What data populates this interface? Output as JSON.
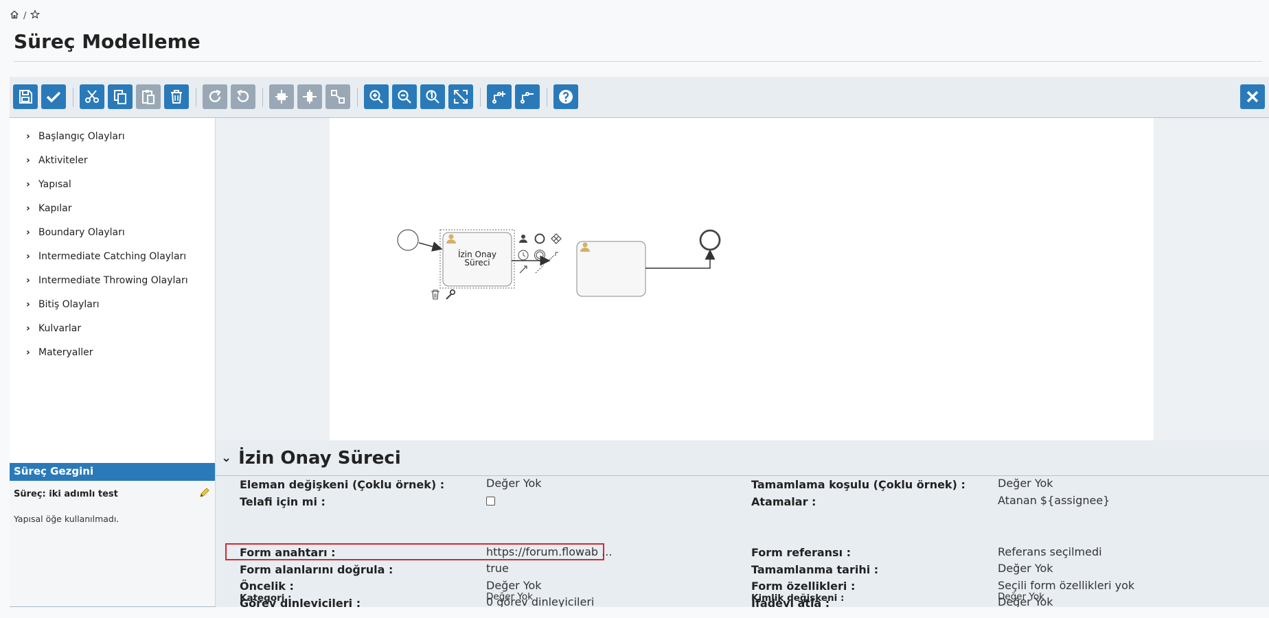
{
  "page": {
    "title": "Süreç Modelleme"
  },
  "breadcrumb": {
    "separator": "/"
  },
  "toolbar": {
    "buttons": [
      "save-icon",
      "check-icon",
      "cut-icon",
      "copy-icon",
      "paste-icon",
      "delete-icon",
      "redo-icon",
      "undo-icon",
      "align-vertical-icon",
      "align-horizontal-icon",
      "same-size-icon",
      "zoom-in-icon",
      "zoom-out-icon",
      "zoom-actual-icon",
      "zoom-fit-icon",
      "add-bendpoint-icon",
      "remove-bendpoint-icon",
      "help-icon"
    ],
    "close": "close-icon",
    "colors": {
      "primary": "#2a7ab9",
      "disabled": "#9aa8b5"
    }
  },
  "palette": {
    "items": [
      "Başlangıç Olayları",
      "Aktiviteler",
      "Yapısal",
      "Kapılar",
      "Boundary Olayları",
      "Intermediate Catching Olayları",
      "Intermediate Throwing Olayları",
      "Bitiş Olayları",
      "Kulvarlar",
      "Materyaller"
    ]
  },
  "diagram": {
    "task1_label": "İzin Onay\nSüreci",
    "task1_line1": "İzin Onay",
    "task1_line2": "Süreci"
  },
  "navigator": {
    "title": "Süreç Gezgini",
    "process_label": "Süreç: iki adımlı test",
    "empty_text": "Yapısal öğe kullanılmadı."
  },
  "properties": {
    "title": "İzin Onay Süreci",
    "left": [
      {
        "label": "Eleman değişkeni (Çoklu örnek) :",
        "value": "Değer Yok"
      },
      {
        "label": "Telafi için mi :",
        "value": ""
      },
      {
        "label": "Form anahtarı :",
        "value": "https://forum.flowab ..."
      },
      {
        "label": "Form alanlarını doğrula :",
        "value": "true"
      },
      {
        "label": "Öncelik :",
        "value": "Değer Yok"
      },
      {
        "label": "Görev dinleyicileri :",
        "value": "0 görev dinleyicileri"
      },
      {
        "label": "Kategori :",
        "value": "Değer Yok"
      }
    ],
    "right": [
      {
        "label": "Tamamlama koşulu (Çoklu örnek) :",
        "value": "Değer Yok"
      },
      {
        "label": "Atamalar :",
        "value": "Atanan ${assignee}"
      },
      {
        "label": "Form referansı :",
        "value": "Referans seçilmedi"
      },
      {
        "label": "Tamamlanma tarihi :",
        "value": "Değer Yok"
      },
      {
        "label": "Form özellikleri :",
        "value": "Seçili form özellikleri yok"
      },
      {
        "label": "İfadeyi atla :",
        "value": "Değer Yok"
      },
      {
        "label": "Kimlik değişkeni :",
        "value": "Değer Yok"
      }
    ]
  }
}
